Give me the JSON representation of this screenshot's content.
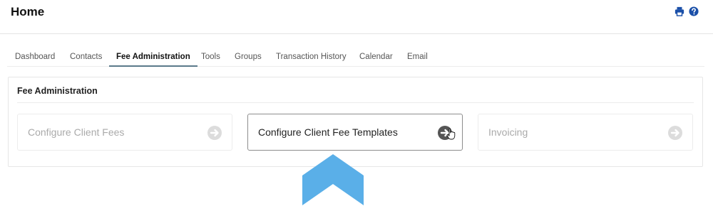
{
  "header": {
    "title": "Home",
    "print_icon": "print-icon",
    "help_icon": "help-icon",
    "icon_color": "#1a4fa8"
  },
  "tabs": [
    {
      "label": "Dashboard",
      "active": false
    },
    {
      "label": "Contacts",
      "active": false
    },
    {
      "label": "Fee Administration",
      "active": true
    },
    {
      "label": "Tools",
      "active": false
    },
    {
      "label": "Groups",
      "active": false
    },
    {
      "label": "Transaction History",
      "active": false
    },
    {
      "label": "Calendar",
      "active": false
    },
    {
      "label": "Email",
      "active": false
    }
  ],
  "panel": {
    "title": "Fee Administration",
    "cards": [
      {
        "label": "Configure Client Fees",
        "icon": "arrow-circle-right-icon",
        "state": "disabled"
      },
      {
        "label": "Configure Client Fee Templates",
        "icon": "arrow-circle-right-icon",
        "state": "hovered"
      },
      {
        "label": "Invoicing",
        "icon": "arrow-circle-right-icon",
        "state": "disabled"
      }
    ]
  },
  "annotation": {
    "icon": "up-arrow-icon",
    "color": "#5aafe8"
  }
}
